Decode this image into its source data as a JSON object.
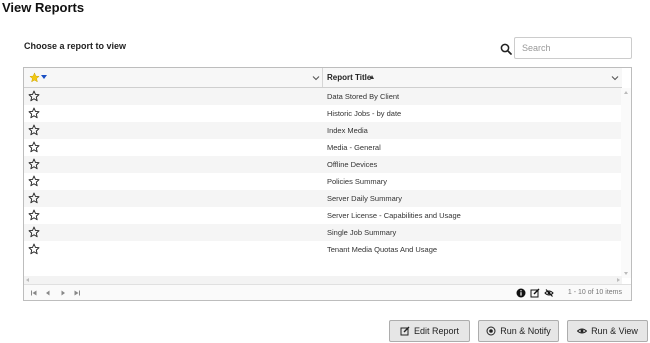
{
  "page": {
    "title": "View Reports",
    "subtitle": "Choose a report to view"
  },
  "search": {
    "placeholder": "Search",
    "icon": "search-icon"
  },
  "grid": {
    "columns": [
      {
        "id": "favorite",
        "label": "",
        "icon": "star-icon"
      },
      {
        "id": "report_title",
        "label": "Report Title",
        "sort": "ascending"
      }
    ],
    "rows": [
      {
        "favorite": false,
        "title": "Data Stored By Client"
      },
      {
        "favorite": false,
        "title": "Historic Jobs - by date"
      },
      {
        "favorite": false,
        "title": "Index Media"
      },
      {
        "favorite": false,
        "title": "Media - General"
      },
      {
        "favorite": false,
        "title": "Offline Devices"
      },
      {
        "favorite": false,
        "title": "Policies Summary"
      },
      {
        "favorite": false,
        "title": "Server Daily Summary"
      },
      {
        "favorite": false,
        "title": "Server License - Capabilities and Usage"
      },
      {
        "favorite": false,
        "title": "Single Job Summary"
      },
      {
        "favorite": false,
        "title": "Tenant Media Quotas And Usage"
      }
    ],
    "footer": {
      "pager_icons": [
        "first-page-icon",
        "prev-page-icon",
        "next-page-icon",
        "last-page-icon"
      ],
      "action_icons": [
        "info-icon",
        "edit-icon",
        "no-view-icon"
      ],
      "items_text": "1 - 10 of 10 items"
    }
  },
  "buttons": {
    "edit_report": "Edit Report",
    "run_notify": "Run & Notify",
    "run_view": "Run & View"
  },
  "colors": {
    "favorite_star": "#f2c811",
    "sort_indicator": "#1a4fc4",
    "button_bg": "#e6e6e6"
  }
}
